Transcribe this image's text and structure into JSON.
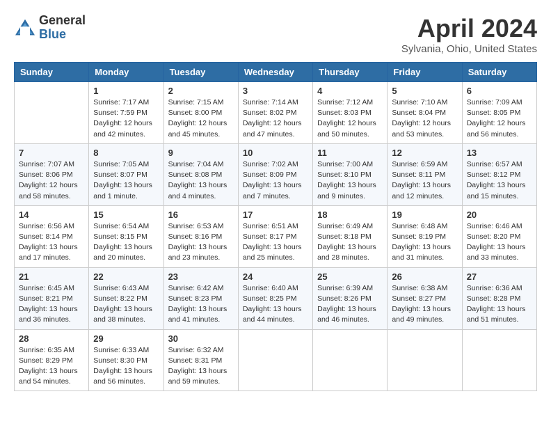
{
  "header": {
    "logo_general": "General",
    "logo_blue": "Blue",
    "month_title": "April 2024",
    "location": "Sylvania, Ohio, United States"
  },
  "days_of_week": [
    "Sunday",
    "Monday",
    "Tuesday",
    "Wednesday",
    "Thursday",
    "Friday",
    "Saturday"
  ],
  "weeks": [
    [
      {
        "day": "",
        "info": ""
      },
      {
        "day": "1",
        "info": "Sunrise: 7:17 AM\nSunset: 7:59 PM\nDaylight: 12 hours and 42 minutes."
      },
      {
        "day": "2",
        "info": "Sunrise: 7:15 AM\nSunset: 8:00 PM\nDaylight: 12 hours and 45 minutes."
      },
      {
        "day": "3",
        "info": "Sunrise: 7:14 AM\nSunset: 8:02 PM\nDaylight: 12 hours and 47 minutes."
      },
      {
        "day": "4",
        "info": "Sunrise: 7:12 AM\nSunset: 8:03 PM\nDaylight: 12 hours and 50 minutes."
      },
      {
        "day": "5",
        "info": "Sunrise: 7:10 AM\nSunset: 8:04 PM\nDaylight: 12 hours and 53 minutes."
      },
      {
        "day": "6",
        "info": "Sunrise: 7:09 AM\nSunset: 8:05 PM\nDaylight: 12 hours and 56 minutes."
      }
    ],
    [
      {
        "day": "7",
        "info": "Sunrise: 7:07 AM\nSunset: 8:06 PM\nDaylight: 12 hours and 58 minutes."
      },
      {
        "day": "8",
        "info": "Sunrise: 7:05 AM\nSunset: 8:07 PM\nDaylight: 13 hours and 1 minute."
      },
      {
        "day": "9",
        "info": "Sunrise: 7:04 AM\nSunset: 8:08 PM\nDaylight: 13 hours and 4 minutes."
      },
      {
        "day": "10",
        "info": "Sunrise: 7:02 AM\nSunset: 8:09 PM\nDaylight: 13 hours and 7 minutes."
      },
      {
        "day": "11",
        "info": "Sunrise: 7:00 AM\nSunset: 8:10 PM\nDaylight: 13 hours and 9 minutes."
      },
      {
        "day": "12",
        "info": "Sunrise: 6:59 AM\nSunset: 8:11 PM\nDaylight: 13 hours and 12 minutes."
      },
      {
        "day": "13",
        "info": "Sunrise: 6:57 AM\nSunset: 8:12 PM\nDaylight: 13 hours and 15 minutes."
      }
    ],
    [
      {
        "day": "14",
        "info": "Sunrise: 6:56 AM\nSunset: 8:14 PM\nDaylight: 13 hours and 17 minutes."
      },
      {
        "day": "15",
        "info": "Sunrise: 6:54 AM\nSunset: 8:15 PM\nDaylight: 13 hours and 20 minutes."
      },
      {
        "day": "16",
        "info": "Sunrise: 6:53 AM\nSunset: 8:16 PM\nDaylight: 13 hours and 23 minutes."
      },
      {
        "day": "17",
        "info": "Sunrise: 6:51 AM\nSunset: 8:17 PM\nDaylight: 13 hours and 25 minutes."
      },
      {
        "day": "18",
        "info": "Sunrise: 6:49 AM\nSunset: 8:18 PM\nDaylight: 13 hours and 28 minutes."
      },
      {
        "day": "19",
        "info": "Sunrise: 6:48 AM\nSunset: 8:19 PM\nDaylight: 13 hours and 31 minutes."
      },
      {
        "day": "20",
        "info": "Sunrise: 6:46 AM\nSunset: 8:20 PM\nDaylight: 13 hours and 33 minutes."
      }
    ],
    [
      {
        "day": "21",
        "info": "Sunrise: 6:45 AM\nSunset: 8:21 PM\nDaylight: 13 hours and 36 minutes."
      },
      {
        "day": "22",
        "info": "Sunrise: 6:43 AM\nSunset: 8:22 PM\nDaylight: 13 hours and 38 minutes."
      },
      {
        "day": "23",
        "info": "Sunrise: 6:42 AM\nSunset: 8:23 PM\nDaylight: 13 hours and 41 minutes."
      },
      {
        "day": "24",
        "info": "Sunrise: 6:40 AM\nSunset: 8:25 PM\nDaylight: 13 hours and 44 minutes."
      },
      {
        "day": "25",
        "info": "Sunrise: 6:39 AM\nSunset: 8:26 PM\nDaylight: 13 hours and 46 minutes."
      },
      {
        "day": "26",
        "info": "Sunrise: 6:38 AM\nSunset: 8:27 PM\nDaylight: 13 hours and 49 minutes."
      },
      {
        "day": "27",
        "info": "Sunrise: 6:36 AM\nSunset: 8:28 PM\nDaylight: 13 hours and 51 minutes."
      }
    ],
    [
      {
        "day": "28",
        "info": "Sunrise: 6:35 AM\nSunset: 8:29 PM\nDaylight: 13 hours and 54 minutes."
      },
      {
        "day": "29",
        "info": "Sunrise: 6:33 AM\nSunset: 8:30 PM\nDaylight: 13 hours and 56 minutes."
      },
      {
        "day": "30",
        "info": "Sunrise: 6:32 AM\nSunset: 8:31 PM\nDaylight: 13 hours and 59 minutes."
      },
      {
        "day": "",
        "info": ""
      },
      {
        "day": "",
        "info": ""
      },
      {
        "day": "",
        "info": ""
      },
      {
        "day": "",
        "info": ""
      }
    ]
  ]
}
